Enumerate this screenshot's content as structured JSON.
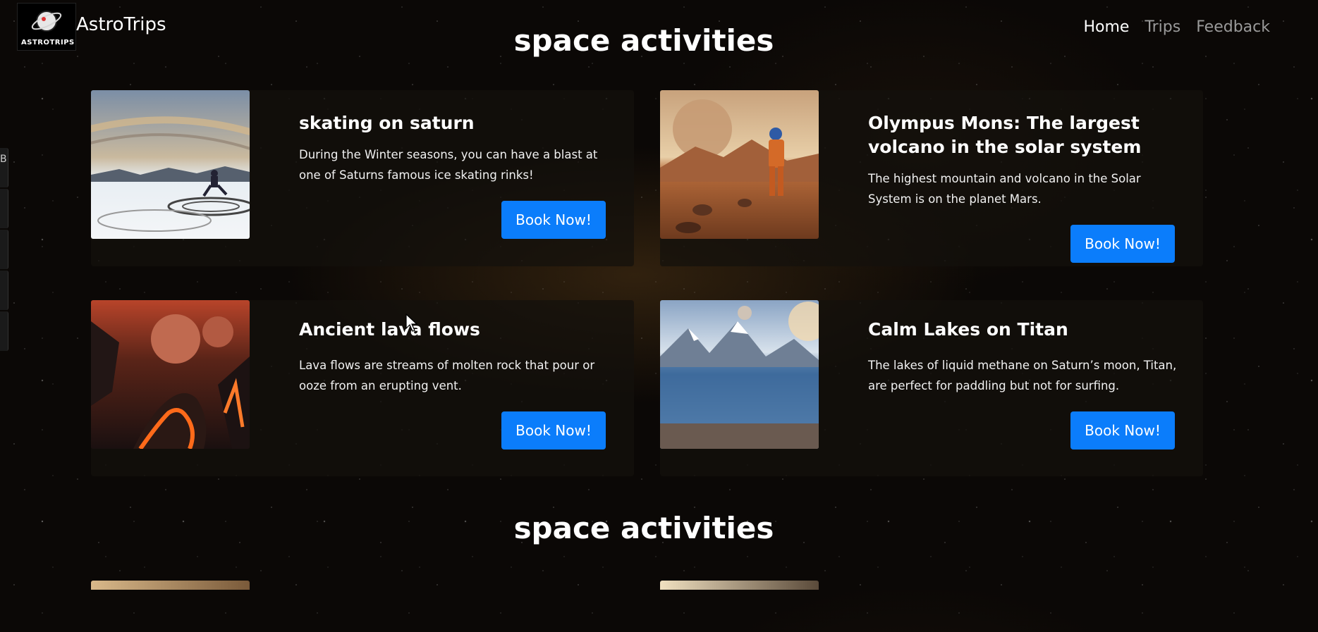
{
  "header": {
    "brand": "AstroTrips",
    "logo_text": "ASTROTRIPS",
    "nav": [
      {
        "label": "Home",
        "active": true
      },
      {
        "label": "Trips",
        "active": false
      },
      {
        "label": "Feedback",
        "active": false
      }
    ]
  },
  "edge_widget": {
    "letter": "B"
  },
  "sections": [
    {
      "title": "space activities",
      "cards": [
        {
          "title": "skating on saturn",
          "text": "During the Winter seasons, you can have a blast at one of Saturns famous ice skating rinks!",
          "button": "Book Now!",
          "image": "saturn-skating-image"
        },
        {
          "title": "Olympus Mons: The largest volcano in the solar system",
          "text": "The highest mountain and volcano in the Solar System is on the planet Mars.",
          "button": "Book Now!",
          "image": "mars-astronaut-image"
        },
        {
          "title": "Ancient lava flows",
          "text": "Lava flows are streams of molten rock that pour or ooze from an erupting vent.",
          "button": "Book Now!",
          "image": "lava-flow-image"
        },
        {
          "title": "Calm Lakes on Titan",
          "text": "The lakes of liquid methane on Saturn’s moon, Titan, are perfect for paddling but not for surfing.",
          "button": "Book Now!",
          "image": "titan-lake-image"
        }
      ]
    },
    {
      "title": "space activities"
    }
  ],
  "colors": {
    "button": "#0b7dfb",
    "background": "#0b0806",
    "nav_inactive": "#9a9a9a"
  }
}
